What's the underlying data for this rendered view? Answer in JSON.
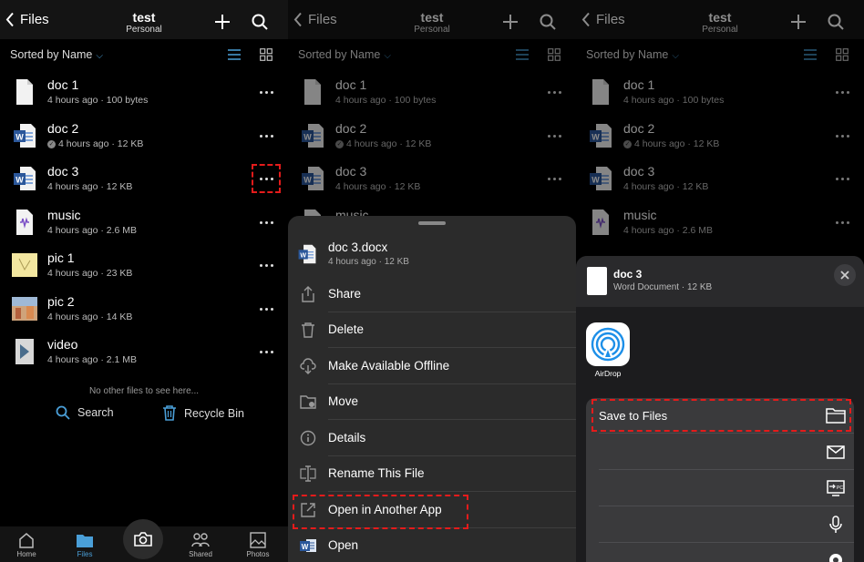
{
  "colors": {
    "accent": "#4a9fd8",
    "highlight": "#e41b1b",
    "word_blue": "#2b579a"
  },
  "header": {
    "back_label": "Files",
    "title": "test",
    "subtitle": "Personal"
  },
  "sort": {
    "label": "Sorted by Name"
  },
  "files": [
    {
      "name": "doc 1",
      "meta": "4 hours ago · 100 bytes",
      "icon": "document-icon"
    },
    {
      "name": "doc 2",
      "meta": "4 hours ago · 12 KB",
      "icon": "word-doc-icon"
    },
    {
      "name": "doc 3",
      "meta": "4 hours ago · 12 KB",
      "icon": "word-doc-icon"
    },
    {
      "name": "music",
      "meta": "4 hours ago · 2.6 MB",
      "icon": "audio-file-icon"
    },
    {
      "name": "pic 1",
      "meta": "4 hours ago · 23 KB",
      "icon": "image-thumbnail"
    },
    {
      "name": "pic 2",
      "meta": "4 hours ago · 14 KB",
      "icon": "image-thumbnail"
    },
    {
      "name": "video",
      "meta": "4 hours ago · 2.1 MB",
      "icon": "video-thumbnail"
    }
  ],
  "empty": {
    "message": "No other files to see here...",
    "search_label": "Search",
    "recycle_label": "Recycle Bin"
  },
  "tabs": {
    "home": "Home",
    "files": "Files",
    "shared": "Shared",
    "photos": "Photos"
  },
  "sheet": {
    "file_name": "doc 3.docx",
    "file_meta": "4 hours ago · 12 KB",
    "actions": [
      {
        "label": "Share",
        "icon": "share-icon"
      },
      {
        "label": "Delete",
        "icon": "trash-icon"
      },
      {
        "label": "Make Available Offline",
        "icon": "cloud-download-icon"
      },
      {
        "label": "Move",
        "icon": "move-folder-icon"
      },
      {
        "label": "Details",
        "icon": "info-icon"
      },
      {
        "label": "Rename This File",
        "icon": "rename-icon"
      },
      {
        "label": "Open in Another App",
        "icon": "open-external-icon"
      },
      {
        "label": "Open",
        "icon": "word-icon"
      }
    ]
  },
  "share_sheet": {
    "file_name": "doc 3",
    "file_meta": "Word Document · 12 KB",
    "airdrop_label": "AirDrop",
    "save_label": "Save to Files"
  }
}
